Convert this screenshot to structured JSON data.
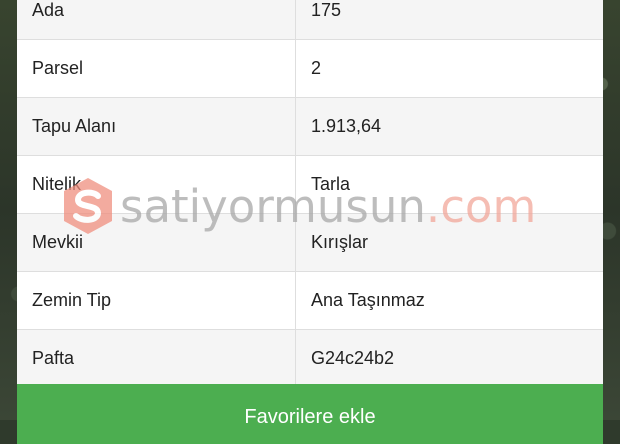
{
  "table": {
    "rows": [
      {
        "label": "Ada",
        "value": "175"
      },
      {
        "label": "Parsel",
        "value": "2"
      },
      {
        "label": "Tapu Alanı",
        "value": "1.913,64"
      },
      {
        "label": "Nitelik",
        "value": "Tarla"
      },
      {
        "label": "Mevkii",
        "value": "Kırışlar"
      },
      {
        "label": "Zemin Tip",
        "value": "Ana Taşınmaz"
      },
      {
        "label": "Pafta",
        "value": "G24c24b2"
      }
    ]
  },
  "cta": {
    "label": "Favorilere ekle"
  },
  "watermark": {
    "text_main": "satiyormusun",
    "text_tld": ".com",
    "logo_icon": "s-logo-icon"
  },
  "colors": {
    "cta": "#4cae50",
    "watermark_logo": "#f08f7f"
  }
}
